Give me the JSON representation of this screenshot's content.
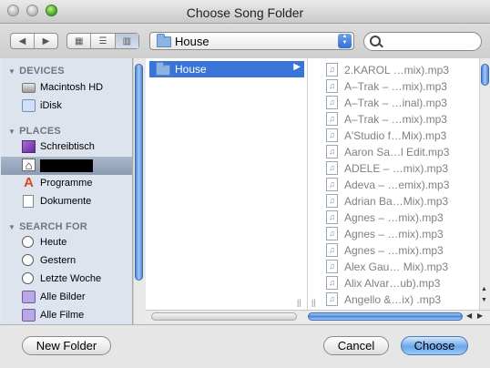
{
  "window": {
    "title": "Choose Song Folder"
  },
  "toolbar": {
    "back_icon": "back-arrow-icon",
    "forward_icon": "forward-arrow-icon",
    "views": [
      "icon-view-icon",
      "list-view-icon",
      "column-view-icon"
    ],
    "active_view": "column",
    "location_popup": "House",
    "search_value": ""
  },
  "sidebar": {
    "devices_header": "DEVICES",
    "devices": [
      "Macintosh HD",
      "iDisk"
    ],
    "places_header": "PLACES",
    "places": [
      "Schreibtisch",
      "",
      "Programme",
      "Dokumente"
    ],
    "search_header": "SEARCH FOR",
    "searches": [
      "Heute",
      "Gestern",
      "Letzte Woche",
      "Alle Bilder",
      "Alle Filme"
    ]
  },
  "browser": {
    "column1": [
      "House"
    ],
    "column2": [
      "2.KAROL …mix).mp3",
      "A–Trak – …mix).mp3",
      "A–Trak – …inal).mp3",
      "A–Trak – …mix).mp3",
      "A'Studio f…Mix).mp3",
      "Aaron Sa…l Edit.mp3",
      "ADELE – …mix).mp3",
      "Adeva – …emix).mp3",
      "Adrian Ba…Mix).mp3",
      "Agnes – …mix).mp3",
      "Agnes – …mix).mp3",
      "Agnes – …mix).mp3",
      "Alex Gau… Mix).mp3",
      "Alix Alvar…ub).mp3",
      "Angello &…ix) .mp3"
    ]
  },
  "buttons": {
    "new_folder": "New Folder",
    "cancel": "Cancel",
    "choose": "Choose"
  },
  "colors": {
    "selection": "#3875d7",
    "sidebar_bg": "#dde4ee",
    "accent_button": "#6aa6ea"
  }
}
